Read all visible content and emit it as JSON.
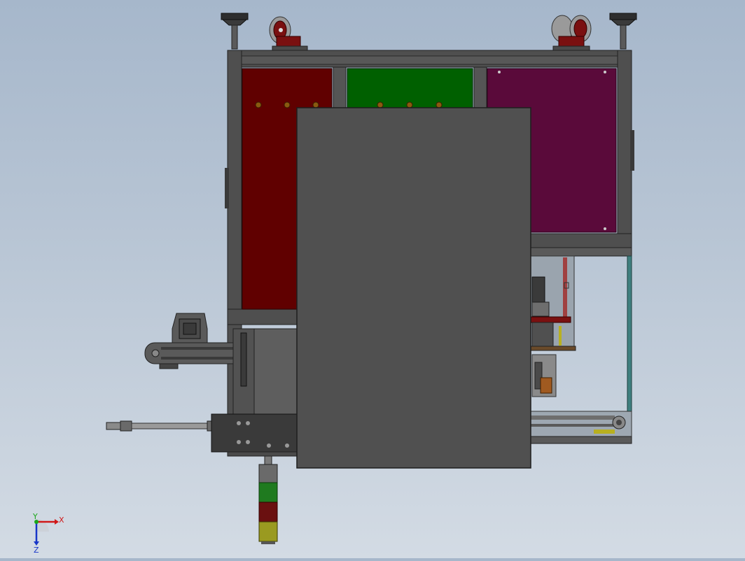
{
  "view": {
    "background_top": "#a6b7cb",
    "background_bottom": "#d3dbe4"
  },
  "triad": {
    "x_label": "X",
    "y_label": "Y",
    "z_label": "Z",
    "x_color": "#d01818",
    "y_color": "#1aa61a",
    "z_color": "#1836c8"
  },
  "colors": {
    "frame": "#4f4f4f",
    "frame_edge": "#2a2a2a",
    "panel_red": "#600000",
    "panel_green": "#006000",
    "panel_magenta": "#5a0a3a",
    "cover": "#505050",
    "stack_light_green": "#1f7a1f",
    "stack_light_red": "#6a1010",
    "stack_light_yellow": "#9a9a20",
    "caster_wheel": "#7a1010",
    "bolt": "#8a5a10"
  },
  "icons": {
    "triad": "coordinate-triad-icon",
    "caster": "caster-wheel-icon",
    "leveling_foot": "leveling-foot-icon"
  }
}
